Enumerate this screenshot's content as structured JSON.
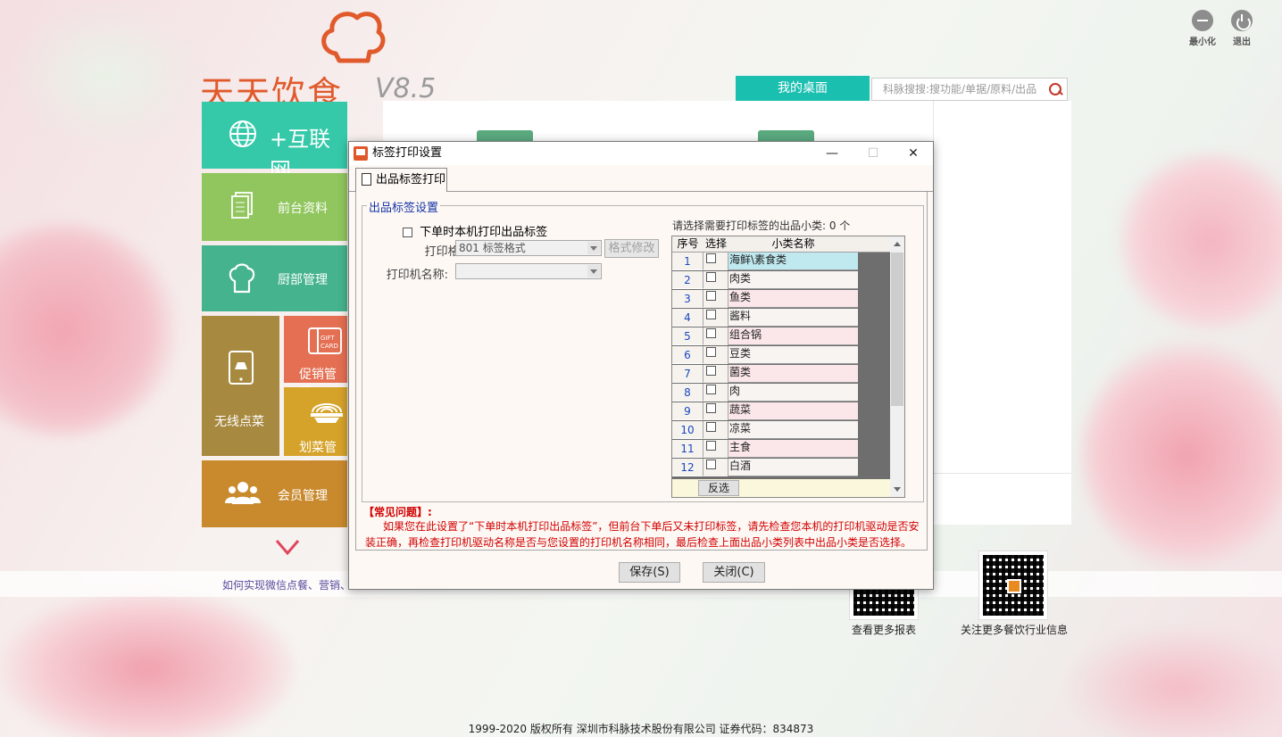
{
  "app": {
    "logo_text": "天天饮食",
    "version": "V8.5",
    "minimize_label": "最小化",
    "exit_label": "退出",
    "desk_tab": "我的桌面",
    "search_placeholder": "科脉搜搜:搜功能/单据/原料/出品"
  },
  "tiles": {
    "internet": "+互联网",
    "front": "前台资料",
    "kitchen": "厨部管理",
    "wireless": "无线点菜",
    "promo": "促销管理",
    "dish": "划菜管理",
    "member": "会员管理"
  },
  "news": "如何实现微信点餐、营销、",
  "qr": {
    "left_label": "查看更多报表",
    "right_label": "关注更多餐饮行业信息"
  },
  "footer": "1999-2020  版权所有   深圳市科脉技术股份有限公司   证券代码：834873",
  "dialog": {
    "title": "标签打印设置",
    "minimize": "—",
    "maximize": "☐",
    "close": "✕",
    "tab": "出品标签打印",
    "group_title": "出品标签设置",
    "checkbox_label": "下单时本机打印出品标签",
    "format_label": "打印格式:",
    "format_value": "801 标签格式",
    "format_edit": "格式修改",
    "printer_label": "打印机名称:",
    "printer_value": "",
    "select_prompt": "请选择需要打印标签的出品小类: 0 个",
    "col_seq": "序号",
    "col_sel": "选择",
    "col_name": "小类名称",
    "rows": [
      {
        "seq": "1",
        "name": "海鲜\\素食类"
      },
      {
        "seq": "2",
        "name": "肉类"
      },
      {
        "seq": "3",
        "name": "鱼类"
      },
      {
        "seq": "4",
        "name": "酱料"
      },
      {
        "seq": "5",
        "name": "组合锅"
      },
      {
        "seq": "6",
        "name": "豆类"
      },
      {
        "seq": "7",
        "name": "菌类"
      },
      {
        "seq": "8",
        "name": "肉"
      },
      {
        "seq": "9",
        "name": "蔬菜"
      },
      {
        "seq": "10",
        "name": "凉菜"
      },
      {
        "seq": "11",
        "name": "主食"
      },
      {
        "seq": "12",
        "name": "白酒"
      }
    ],
    "invert_btn": "反选",
    "faq_title": "【常见问题】:",
    "faq_body": "如果您在此设置了“下单时本机打印出品标签”，但前台下单后又未打印标签，请先检查您本机的打印机驱动是否安装正确，再检查打印机驱动名称是否与您设置的打印机名称相同，最后检查上面出品小类列表中出品小类是否选择。",
    "save_btn": "保存(S)",
    "close_btn": "关闭(C)"
  },
  "colors": {
    "accent": "#1bbfb0",
    "logo": "#e05a2c",
    "faq": "#d10000",
    "selected_row": "#bfe8ef",
    "alt_row": "#fbe7e9"
  }
}
